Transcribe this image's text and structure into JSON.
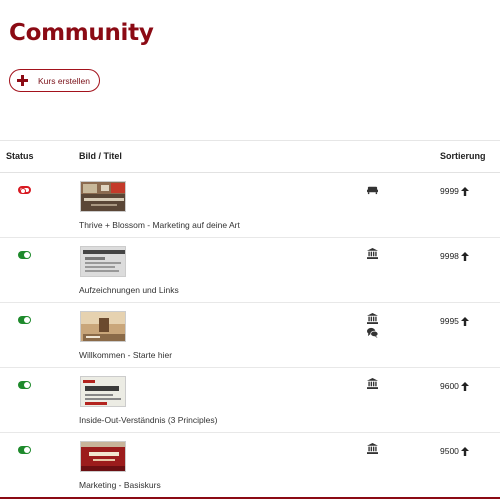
{
  "page": {
    "title": "Community"
  },
  "toolbar": {
    "create_label": "Kurs erstellen"
  },
  "table": {
    "headers": {
      "status": "Status",
      "title": "Bild / Titel",
      "sort": "Sortierung"
    },
    "rows": [
      {
        "title": "Thrive + Blossom - Marketing auf deine Art",
        "sort": "9999",
        "status": "inactive",
        "icons": [
          "sofa-icon"
        ]
      },
      {
        "title": "Aufzeichnungen und Links",
        "sort": "9998",
        "status": "active",
        "icons": [
          "bank-icon"
        ]
      },
      {
        "title": "Willkommen - Starte hier",
        "sort": "9995",
        "status": "active",
        "icons": [
          "bank-icon",
          "comments-icon"
        ]
      },
      {
        "title": "Inside-Out-Verständnis (3 Principles)",
        "sort": "9600",
        "status": "active",
        "icons": [
          "bank-icon"
        ]
      },
      {
        "title": "Marketing - Basiskurs",
        "sort": "9500",
        "status": "active",
        "icons": [
          "bank-icon"
        ]
      }
    ]
  },
  "colors": {
    "accent": "#8b0a14",
    "active": "#1e8a2c",
    "inactive": "#d81a22"
  }
}
